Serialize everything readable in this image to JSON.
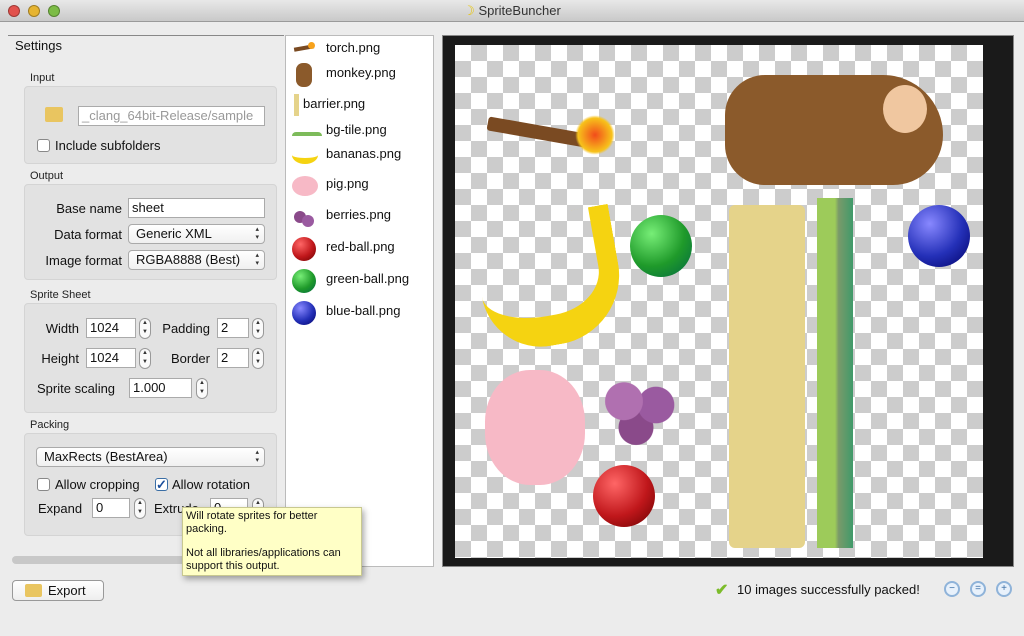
{
  "window": {
    "title": "SpriteBuncher",
    "app_icon": "banana-icon"
  },
  "settings": {
    "tab_label": "Settings",
    "input": {
      "label": "Input",
      "path_value": "_clang_64bit-Release/sample",
      "include_subfolders_label": "Include subfolders",
      "include_subfolders": false
    },
    "output": {
      "label": "Output",
      "base_name_label": "Base name",
      "base_name": "sheet",
      "data_format_label": "Data format",
      "data_format": "Generic XML",
      "image_format_label": "Image format",
      "image_format": "RGBA8888 (Best)"
    },
    "sprite_sheet": {
      "label": "Sprite Sheet",
      "width_label": "Width",
      "width": "1024",
      "height_label": "Height",
      "height": "1024",
      "padding_label": "Padding",
      "padding": "2",
      "border_label": "Border",
      "border": "2",
      "scaling_label": "Sprite scaling",
      "scaling": "1.000"
    },
    "packing": {
      "label": "Packing",
      "algorithm": "MaxRects (BestArea)",
      "allow_cropping_label": "Allow cropping",
      "allow_cropping": false,
      "allow_rotation_label": "Allow rotation",
      "allow_rotation": true,
      "expand_label": "Expand",
      "expand": "0",
      "extrude_label": "Extrude",
      "extrude": "0"
    }
  },
  "tooltip": {
    "line1": "Will rotate sprites for better packing.",
    "line2": "Not all libraries/applications can support this output."
  },
  "files": [
    {
      "name": "torch.png",
      "icon": "torch-icon"
    },
    {
      "name": "monkey.png",
      "icon": "monkey-icon"
    },
    {
      "name": "barrier.png",
      "icon": "barrier-icon"
    },
    {
      "name": "bg-tile.png",
      "icon": "bg-tile-icon"
    },
    {
      "name": "bananas.png",
      "icon": "bananas-icon"
    },
    {
      "name": "pig.png",
      "icon": "pig-icon"
    },
    {
      "name": "berries.png",
      "icon": "berries-icon"
    },
    {
      "name": "red-ball.png",
      "icon": "red-ball-icon",
      "color": "#c0171b"
    },
    {
      "name": "green-ball.png",
      "icon": "green-ball-icon",
      "color": "#1f9a2a"
    },
    {
      "name": "blue-ball.png",
      "icon": "blue-ball-icon",
      "color": "#2430b8"
    }
  ],
  "footer": {
    "export_label": "Export",
    "status": "10 images successfully packed!",
    "zoom_out": "zoom-out-icon",
    "zoom_reset": "zoom-reset-icon",
    "zoom_in": "zoom-in-icon"
  }
}
